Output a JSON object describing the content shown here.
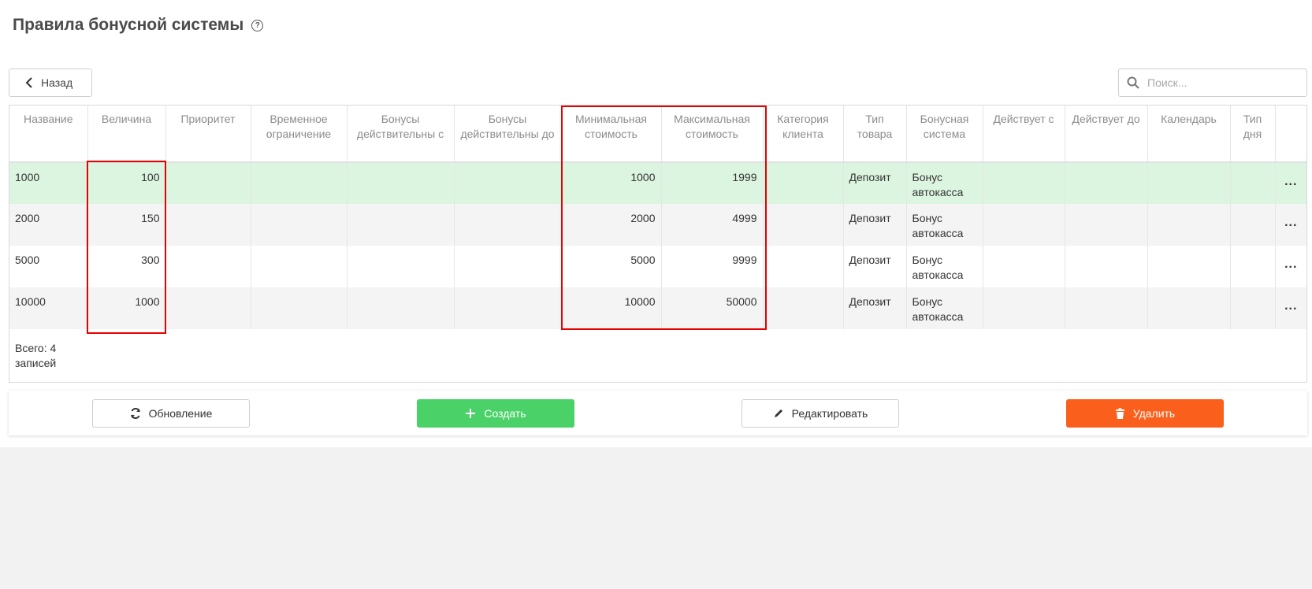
{
  "page": {
    "title": "Правила бонусной системы",
    "help_icon": "question-circle-icon"
  },
  "toolbar": {
    "back_label": "Назад",
    "search_placeholder": "Поиск..."
  },
  "table": {
    "columns": [
      "Название",
      "Величина",
      "Приоритет",
      "Временное ограничение",
      "Бонусы действительны с",
      "Бонусы действительны до",
      "Минимальная стоимость",
      "Максимальная стоимость",
      "Категория клиента",
      "Тип товара",
      "Бонусная система",
      "Действует с",
      "Действует до",
      "Календарь",
      "Тип дня"
    ],
    "rows": [
      {
        "name": "1000",
        "value": "100",
        "min": "1000",
        "max": "1999",
        "product_type": "Депозит",
        "bonus_system": "Бонус автокасса"
      },
      {
        "name": "2000",
        "value": "150",
        "min": "2000",
        "max": "4999",
        "product_type": "Депозит",
        "bonus_system": "Бонус автокасса"
      },
      {
        "name": "5000",
        "value": "300",
        "min": "5000",
        "max": "9999",
        "product_type": "Депозит",
        "bonus_system": "Бонус автокасса"
      },
      {
        "name": "10000",
        "value": "1000",
        "min": "10000",
        "max": "50000",
        "product_type": "Депозит",
        "bonus_system": "Бонус автокасса"
      }
    ],
    "row_menu": "...",
    "total": "Всего: 4 записей",
    "selected_row_color": "#dcf5e0"
  },
  "actions": {
    "refresh_label": "Обновление",
    "create_label": "Создать",
    "edit_label": "Редактировать",
    "delete_label": "Удалить",
    "create_color": "#4ad168",
    "delete_color": "#fa5f1c"
  },
  "highlight_color": "#e60000"
}
